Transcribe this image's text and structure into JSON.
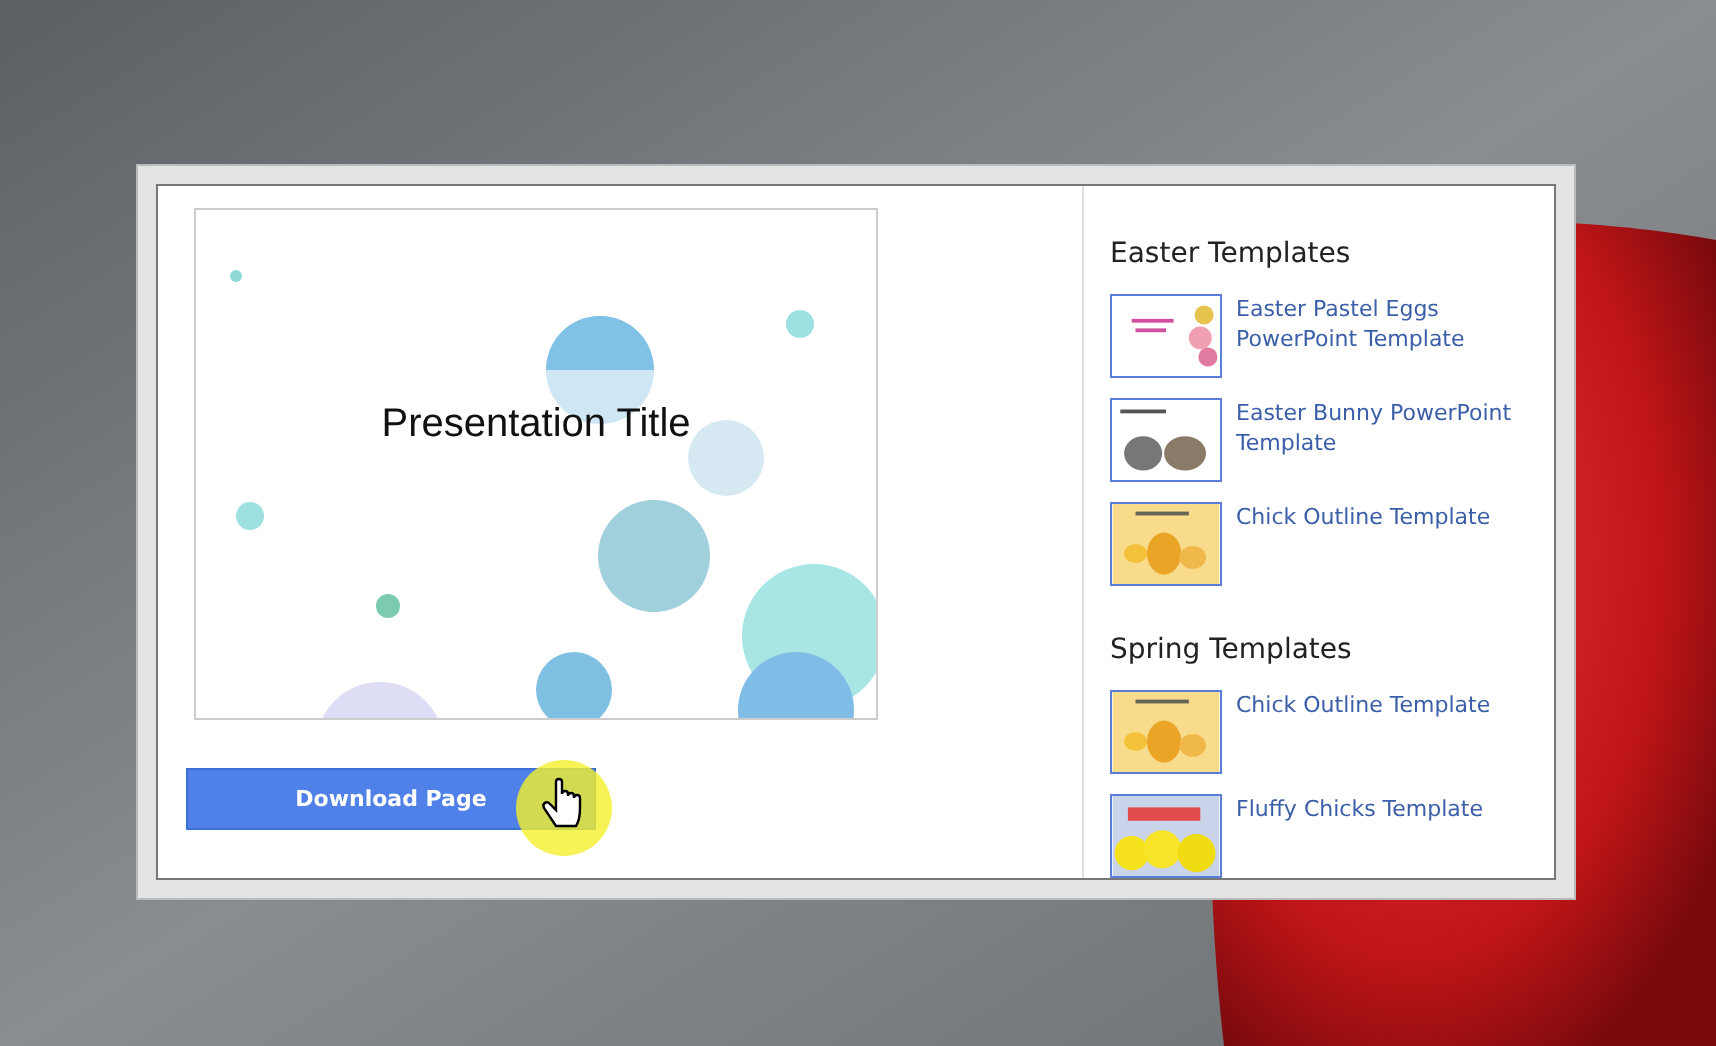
{
  "preview": {
    "title": "Presentation Title"
  },
  "download_button": {
    "label": "Download Page"
  },
  "sections": [
    {
      "heading": "Easter Templates",
      "items": [
        {
          "title": "Easter Pastel Eggs PowerPoint Template",
          "kind": "eggs"
        },
        {
          "title": "Easter Bunny PowerPoint Template",
          "kind": "bunny"
        },
        {
          "title": "Chick Outline Template",
          "kind": "chick"
        }
      ]
    },
    {
      "heading": "Spring Templates",
      "items": [
        {
          "title": "Chick Outline Template",
          "kind": "chick"
        },
        {
          "title": "Fluffy Chicks Template",
          "kind": "fluffy"
        }
      ]
    }
  ]
}
